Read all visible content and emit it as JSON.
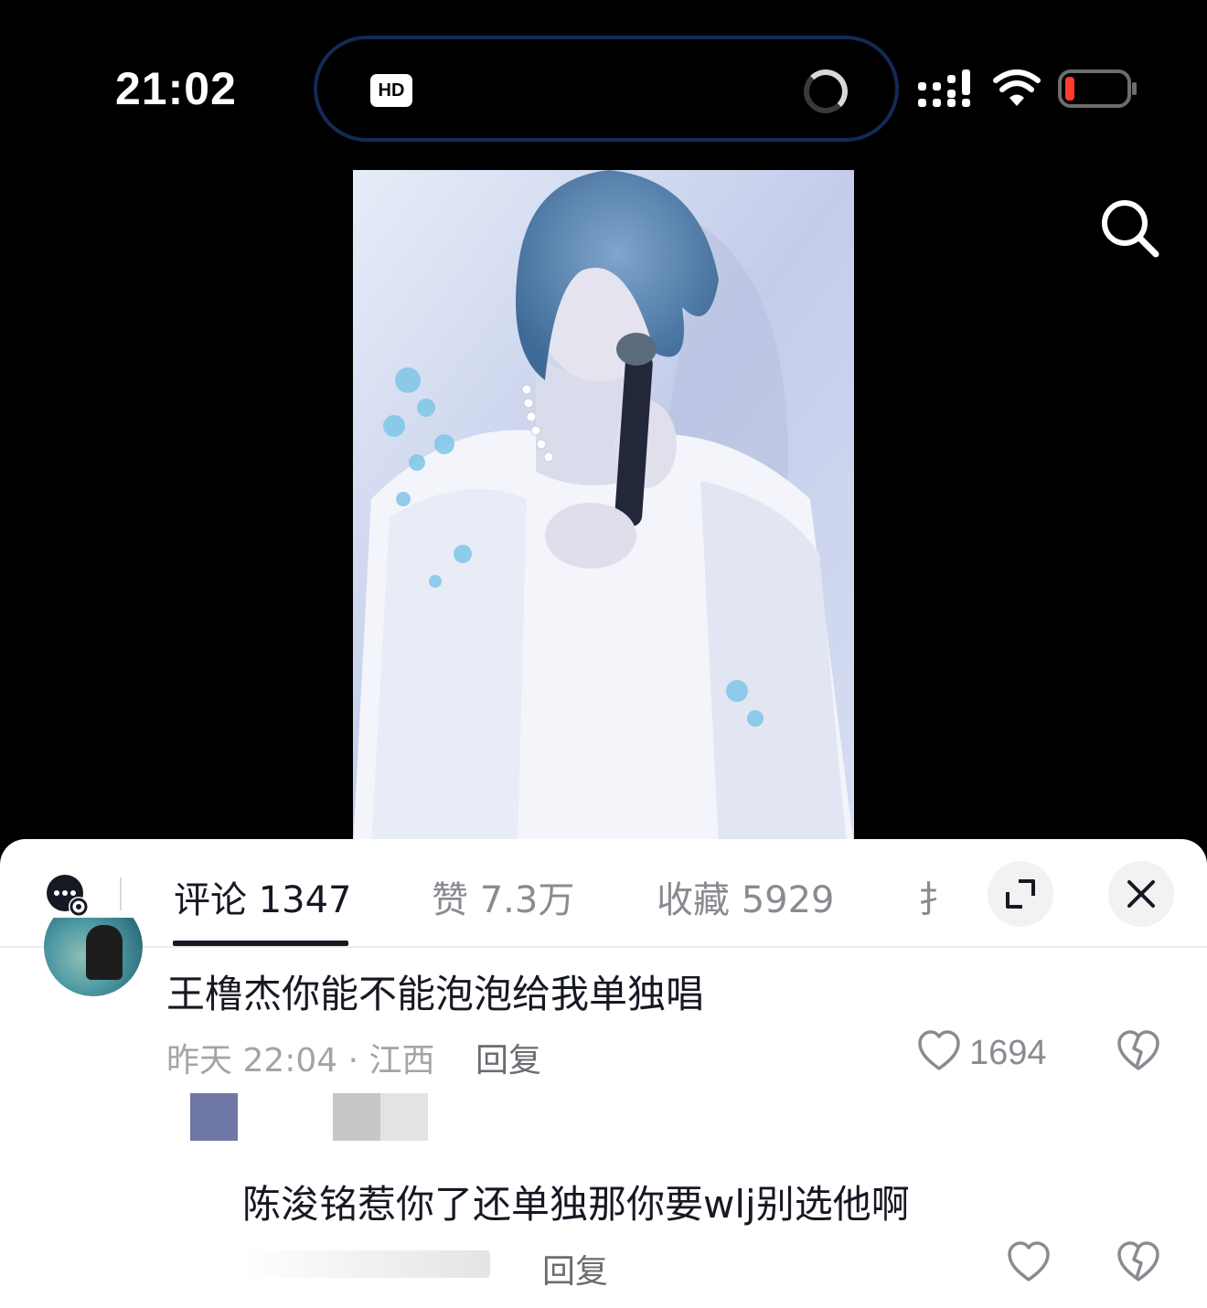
{
  "status_bar": {
    "time": "21:02",
    "hd_badge": "HD",
    "icons": [
      "spinner-icon",
      "signal-icon",
      "wifi-icon",
      "battery-icon"
    ],
    "battery_color": "#ff3b30"
  },
  "video": {
    "icons": [
      "search-icon"
    ]
  },
  "comment_panel": {
    "tabs": [
      {
        "label": "评论 1347",
        "active": true
      },
      {
        "label": "赞 7.3万",
        "active": false
      },
      {
        "label": "收藏 5929",
        "active": false
      },
      {
        "label": "扌",
        "active": false
      }
    ],
    "icons": [
      "chat-settings-icon",
      "expand-icon",
      "close-icon"
    ],
    "comments": [
      {
        "text": "王橹杰你能不能泡泡给我单独唱",
        "meta": "昨天 22:04 · 江西",
        "reply_label": "回复",
        "like_count": "1694"
      },
      {
        "text": "陈浚铭惹你了还单独那你要wlj别选他啊",
        "reply_label": "回复",
        "like_count": ""
      }
    ]
  }
}
